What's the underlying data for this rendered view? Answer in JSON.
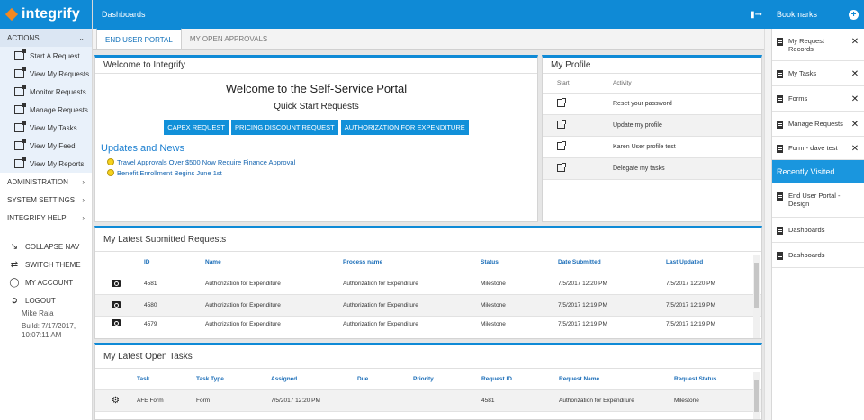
{
  "brand": {
    "name": "integrify"
  },
  "sidebar": {
    "actions_label": "ACTIONS",
    "actions": [
      "Start A Request",
      "View My Requests",
      "Monitor Requests",
      "Manage Requests",
      "View My Tasks",
      "View My Feed",
      "View My Reports"
    ],
    "menus": [
      "ADMINISTRATION",
      "SYSTEM SETTINGS",
      "INTEGRIFY HELP"
    ],
    "utilities": [
      {
        "label": "COLLAPSE NAV",
        "icon": "collapse-icon"
      },
      {
        "label": "SWITCH THEME",
        "icon": "shuffle-icon"
      },
      {
        "label": "MY ACCOUNT",
        "icon": "account-icon"
      },
      {
        "label": "LOGOUT",
        "icon": "logout-icon"
      }
    ],
    "user_name": "Mike Raia",
    "build": "Build: 7/17/2017, 10:07:11 AM"
  },
  "topbar": {
    "title": "Dashboards"
  },
  "tabs": [
    {
      "label": "END USER PORTAL",
      "active": true
    },
    {
      "label": "MY OPEN APPROVALS",
      "active": false
    }
  ],
  "welcome": {
    "panel_title": "Welcome to Integrify",
    "heading": "Welcome to the Self-Service Portal",
    "subheading": "Quick Start Requests",
    "buttons": [
      "CAPEX REQUEST",
      "PRICING DISCOUNT REQUEST",
      "AUTHORIZATION FOR EXPENDITURE"
    ],
    "updates_title": "Updates and News",
    "news": [
      "Travel Approvals Over $500 Now Require Finance Approval",
      "Benefit Enrollment Begins June 1st"
    ]
  },
  "profile": {
    "panel_title": "My Profile",
    "col_start": "Start",
    "col_activity": "Activity",
    "rows": [
      "Reset your password",
      "Update my profile",
      "Karen User profile test",
      "Delegate my tasks"
    ]
  },
  "submitted": {
    "panel_title": "My Latest Submitted Requests",
    "columns": [
      "ID",
      "Name",
      "Process name",
      "Status",
      "Date Submitted",
      "Last Updated"
    ],
    "rows": [
      [
        "4581",
        "Authorization for Expenditure",
        "Authorization for Expenditure",
        "Milestone",
        "7/5/2017 12:20 PM",
        "7/5/2017 12:20 PM"
      ],
      [
        "4580",
        "Authorization for Expenditure",
        "Authorization for Expenditure",
        "Milestone",
        "7/5/2017 12:19 PM",
        "7/5/2017 12:19 PM"
      ],
      [
        "4579",
        "Authorization for Expenditure",
        "Authorization for Expenditure",
        "Milestone",
        "7/5/2017 12:19 PM",
        "7/5/2017 12:19 PM"
      ]
    ]
  },
  "tasks": {
    "panel_title": "My Latest Open Tasks",
    "columns": [
      "Task",
      "Task Type",
      "Assigned",
      "Due",
      "Priority",
      "Request ID",
      "Request Name",
      "Request Status"
    ],
    "rows": [
      [
        "AFE Form",
        "Form",
        "7/5/2017 12:20 PM",
        "",
        "",
        "4581",
        "Authorization for Expenditure",
        "Milestone"
      ]
    ]
  },
  "bookmarks": {
    "title": "Bookmarks",
    "items": [
      "My Request Records",
      "My Tasks",
      "Forms",
      "Manage Requests",
      "Form - dave test"
    ],
    "recent_title": "Recently Visited",
    "recent": [
      "End User Portal - Design",
      "Dashboards",
      "Dashboards"
    ]
  },
  "colors": {
    "brand_blue": "#0f8ad6",
    "logo_orange": "#f5881f"
  }
}
